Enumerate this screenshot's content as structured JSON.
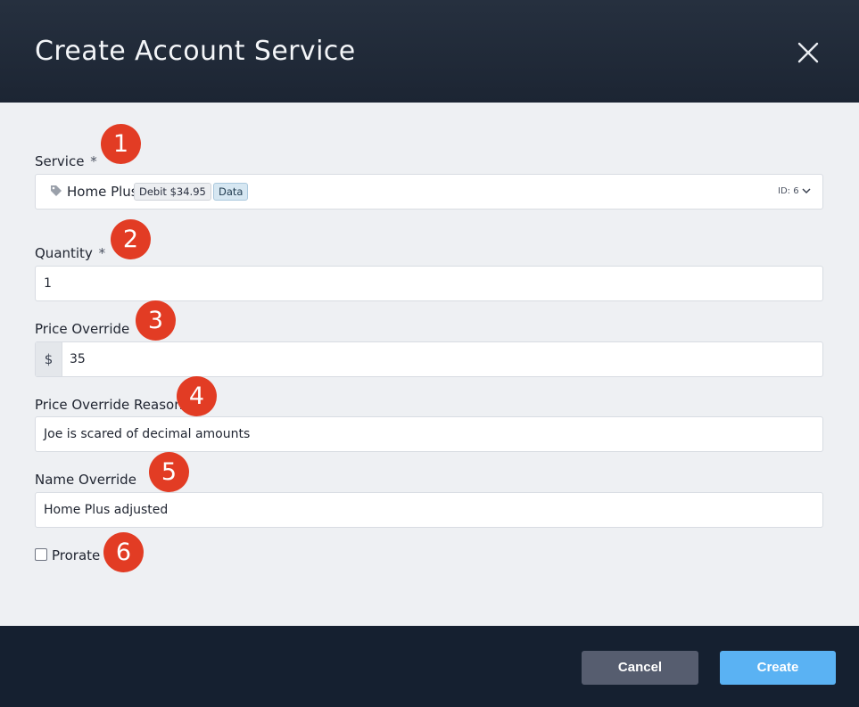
{
  "dialog": {
    "title": "Create Account Service",
    "close_icon": "close-icon"
  },
  "form": {
    "service": {
      "label": "Service",
      "required_mark": "*",
      "icon": "tag-icon",
      "name": "Home Plus",
      "badge_debit": "Debit $34.95",
      "badge_type": "Data",
      "id_text": "ID: 6",
      "dropdown_icon": "chevron-down-icon"
    },
    "quantity": {
      "label": "Quantity",
      "required_mark": "*",
      "value": "1"
    },
    "price_override": {
      "label": "Price Override",
      "prefix": "$",
      "value": "35"
    },
    "price_override_reason": {
      "label": "Price Override Reason",
      "value": "Joe is scared of decimal amounts"
    },
    "name_override": {
      "label": "Name Override",
      "value": "Home Plus adjusted"
    },
    "prorate": {
      "label": "Prorate",
      "checked": false
    }
  },
  "markers": [
    "1",
    "2",
    "3",
    "4",
    "5",
    "6"
  ],
  "footer": {
    "cancel_label": "Cancel",
    "create_label": "Create"
  },
  "colors": {
    "header_bg": "#1f2836",
    "footer_bg": "#152030",
    "body_bg": "#eef0f3",
    "marker_red": "#e23c24",
    "create_blue": "#5ab2f3",
    "cancel_gray": "#565d6f"
  }
}
